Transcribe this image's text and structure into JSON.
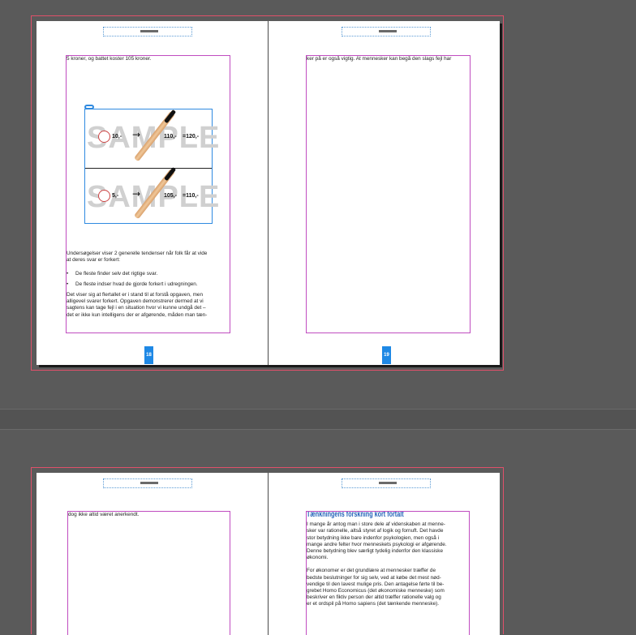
{
  "spread1": {
    "left_page": {
      "text_top": "5 kroner, og battet koster 105 kroner.",
      "figure": {
        "watermark": "SAMPLE",
        "row1": {
          "price_ball": "10,-",
          "price_bat": "110,-",
          "total": "=120,-"
        },
        "row2": {
          "price_ball": "5,-",
          "price_bat": "105,-",
          "total": "=110,-"
        }
      },
      "paragraph1": [
        "Undersøgelser viser 2 generelle tendenser når folk får at vide",
        "at deres svar er forkert:"
      ],
      "bullets": [
        "De fleste finder selv det rigtige svar.",
        "De fleste indser hvad de gjorde forkert i udregningen."
      ],
      "paragraph2": [
        "Det viser sig at flertallet er i stand til at forstå opgaven, men",
        "alligevel svarer forkert. Opgaven demonstrerer dermed at vi",
        "sagtens kan tage fejl i en situation hvor vi kunne undgå det –",
        "det er ikke kun intelligens der er afgørende, måden man tæn-"
      ],
      "page_number": "18"
    },
    "right_page": {
      "text_top": "ker på er også vigtig. At mennesker kan begå den slags fejl har",
      "page_number": "19"
    }
  },
  "spread2": {
    "left_page": {
      "text_top": "dog ikke altid været anerkendt."
    },
    "right_page": {
      "heading": "Tænkningens forskning kort fortalt",
      "paragraph1": [
        "I mange år antog man i store dele af videnskaben at menne-",
        "sker var rationelle, altså styret af logik og fornuft. Det havde",
        "stor betydning ikke bare indenfor psykologien, men også i",
        "mange andre felter hvor menneskets psykologi er afgørende.",
        "Denne betydning blev særligt tydelig indenfor den klassiske",
        "økonomi."
      ],
      "paragraph2": [
        "For økonomer er det grundlære at mennesker træffer de",
        "bedste beslutninger for sig selv, ved at købe det mest nød-",
        "vendige til den lavest mulige pris. Den antagelse førte til be-",
        "grebet Homo Economicus (det økonomiske menneske) som",
        "beskriver en fiktiv person der altid træffer rationelle valg og",
        "er et ordspil på Homo sapiens (det tænkende menneske)."
      ]
    }
  },
  "colors": {
    "pasteboard": "#5a5a5a",
    "bleed": "#e0506a",
    "text_frame": "#c04cc0",
    "image_frame": "#2f8ae0",
    "page_number_bg": "#1e88e5",
    "heading": "#2563b8"
  }
}
